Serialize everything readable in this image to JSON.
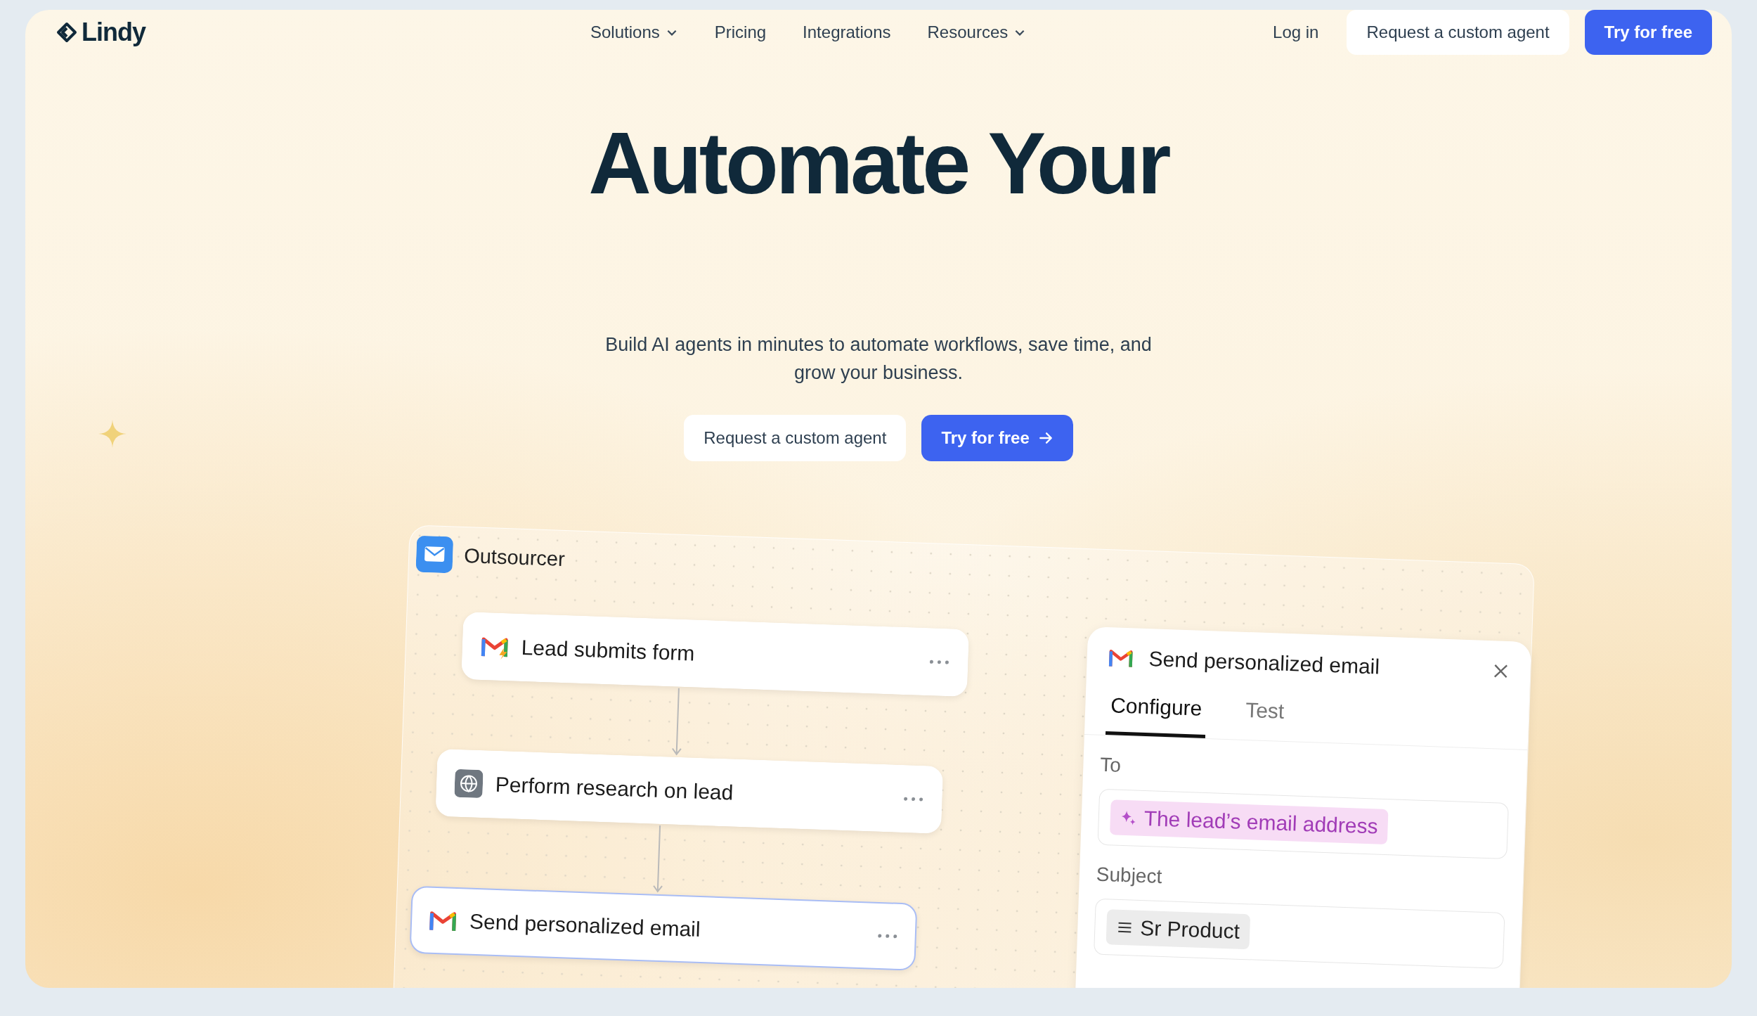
{
  "logo": {
    "text": "Lindy"
  },
  "nav": {
    "links": [
      {
        "label": "Solutions",
        "dropdown": true
      },
      {
        "label": "Pricing",
        "dropdown": false
      },
      {
        "label": "Integrations",
        "dropdown": false
      },
      {
        "label": "Resources",
        "dropdown": true
      }
    ],
    "login": "Log in",
    "secondary_button": "Request a custom agent",
    "primary_button": "Try for free"
  },
  "hero": {
    "title": "Automate Your",
    "subtitle": "Build AI agents in minutes to automate workflows, save time, and grow your business.",
    "secondary_button": "Request a custom agent",
    "primary_button": "Try for free"
  },
  "workflow": {
    "title": "Outsourcer",
    "steps": [
      {
        "label": "Lead submits form",
        "kind": "gmail-trigger",
        "selected": false
      },
      {
        "label": "Perform research on lead",
        "kind": "web",
        "selected": false
      },
      {
        "label": "Send personalized email",
        "kind": "gmail",
        "selected": true
      }
    ],
    "panel": {
      "title": "Send personalized email",
      "tabs": [
        {
          "label": "Configure",
          "selected": true
        },
        {
          "label": "Test",
          "selected": false
        }
      ],
      "fields": [
        {
          "label": "To",
          "chip": "The lead’s email address",
          "kind": "ai"
        },
        {
          "label": "Subject",
          "chip": "Sr Product",
          "kind": "variable"
        }
      ]
    }
  }
}
